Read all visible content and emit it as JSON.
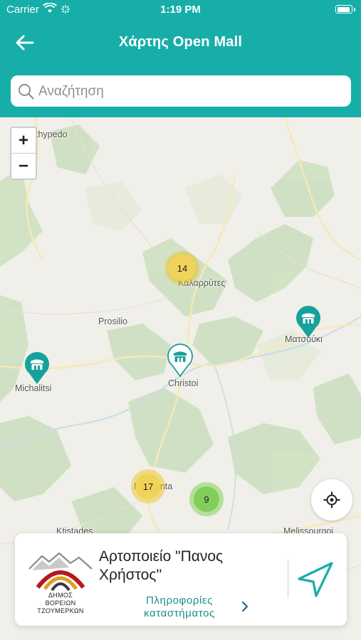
{
  "status_bar": {
    "carrier": "Carrier",
    "time": "1:19 PM"
  },
  "nav": {
    "title": "Χάρτης Open Mall"
  },
  "search": {
    "placeholder": "Αναζήτηση",
    "value": ""
  },
  "map": {
    "zoom_in": "+",
    "zoom_out": "−",
    "labels": {
      "thypedo": "thypedo",
      "kalarrytes": "Καλαρρύτες",
      "prosilio": "Prosilio",
      "christoi": "Christoi",
      "michalitsi": "Michalitsi",
      "matsouki": "Ματσούκι",
      "prama": "Pramanta",
      "ktistades": "Ktistades",
      "melissourgoi": "Melissourgoi"
    },
    "clusters": {
      "c14": "14",
      "c17": "17",
      "c9": "9"
    }
  },
  "card": {
    "shop_name": "Αρτοποιείο \"Πανος Χρήστος''",
    "info_link": "Πληροφορίες καταστήματος",
    "logo_text": "ΔΗΜΟΣ ΒΟΡΕΙΩΝ ΤΖΟΥΜΕΡΚΩΝ"
  },
  "colors": {
    "primary": "#17aeaa",
    "link": "#1a8f8b"
  }
}
